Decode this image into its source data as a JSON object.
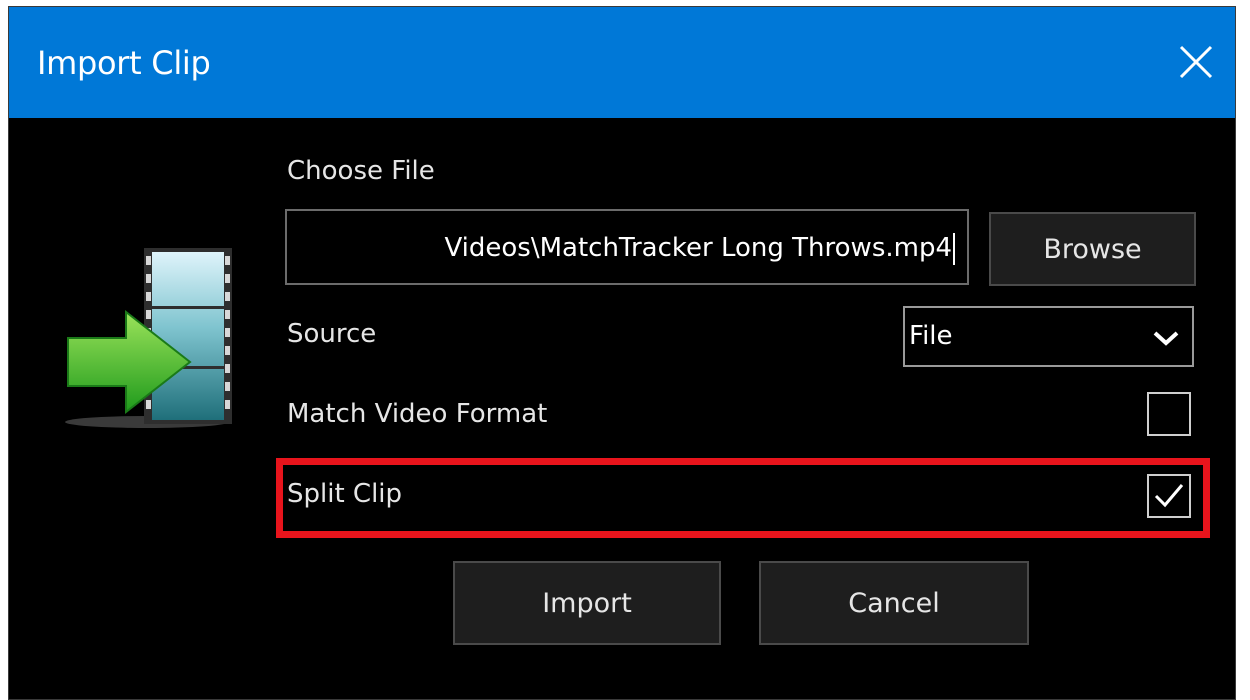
{
  "window": {
    "title": "Import Clip"
  },
  "form": {
    "choose_file_label": "Choose File",
    "file_path_value": "Videos\\MatchTracker Long Throws.mp4",
    "browse_label": "Browse",
    "source_label": "Source",
    "source_selected": "File",
    "match_video_format_label": "Match Video Format",
    "match_video_format_checked": false,
    "split_clip_label": "Split Clip",
    "split_clip_checked": true
  },
  "actions": {
    "import_label": "Import",
    "cancel_label": "Cancel"
  },
  "icons": {
    "close": "close-icon",
    "import_film": "film-import-icon",
    "dropdown": "chevron-down-icon",
    "check": "checkmark-icon"
  },
  "colors": {
    "titlebar": "#0078d7",
    "dialog_bg": "#000000",
    "highlight": "#e8141c",
    "arrow": "#3fbf2a"
  }
}
